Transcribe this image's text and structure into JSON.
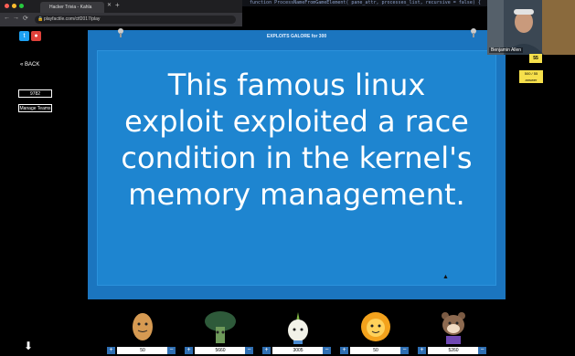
{
  "browser": {
    "tab_title": "Hacker Trivia - Kahla",
    "url": "playfactile.com/ctf2017/play",
    "close_glyph": "✕",
    "new_tab_glyph": "+",
    "back_glyph": "←",
    "forward_glyph": "→",
    "reload_glyph": "⟳"
  },
  "code_strip": {
    "text": "function ProcessNameFromGameElement( pane_attr, processes_list, recursive = false) {"
  },
  "left_panel": {
    "twitter_glyph": "t",
    "other_glyph": "●",
    "back_label": "« BACK",
    "timer_value": "9782",
    "manage_teams_label": "Manage Teams"
  },
  "stage": {
    "title": "EXPLOITS GALORE for 300",
    "question_lines": [
      "This famous linux",
      "exploit exploited a race",
      "condition in the kernel's",
      "memory management."
    ]
  },
  "webcam": {
    "name": "Benjamin Allen"
  },
  "sidebar_badges": {
    "points": "55",
    "action_line1": "500 / 55",
    "action_line2": "answer"
  },
  "bottom": {
    "down_glyph": "⬇"
  },
  "teams": [
    {
      "score": "50",
      "avatar": "potato-icon"
    },
    {
      "score": "5660",
      "avatar": "broccoli-icon"
    },
    {
      "score": "3005",
      "avatar": "onion-icon"
    },
    {
      "score": "50",
      "avatar": "lion-icon"
    },
    {
      "score": "5260",
      "avatar": "hamster-icon"
    }
  ],
  "controls": {
    "plus": "+",
    "minus": "−"
  },
  "colors": {
    "stage_blue": "#1b75bf",
    "card_blue": "#1e85d0",
    "badge_yellow": "#f6e04b",
    "control_blue": "#2f6fb3"
  }
}
